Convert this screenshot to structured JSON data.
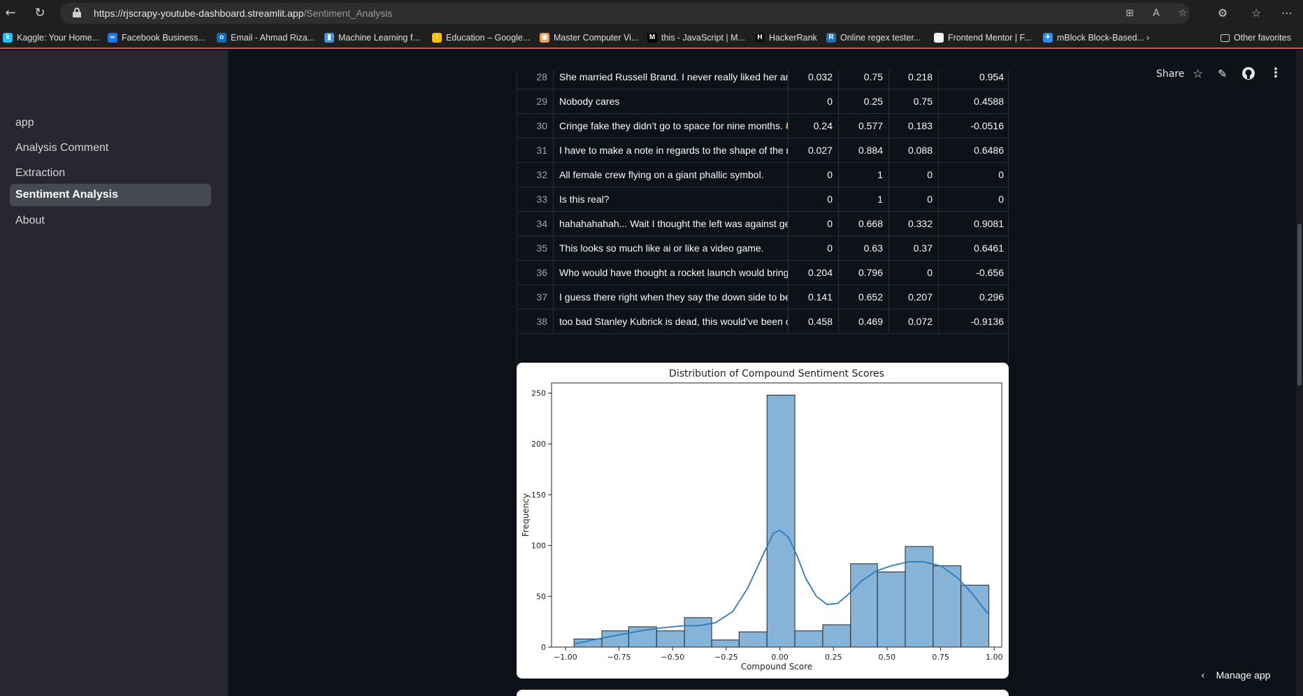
{
  "browser": {
    "url_host": "https://rjscrapy-youtube-dashboard.streamlit.app",
    "url_path": "/Sentiment_Analysis",
    "bookmarks": [
      {
        "label": "Kaggle: Your Home...",
        "color": "#20beff",
        "glyph": "k"
      },
      {
        "label": "Facebook Business...",
        "color": "#1877f2",
        "glyph": "∞"
      },
      {
        "label": "Email - Ahmad Riza...",
        "color": "#0f6cbd",
        "glyph": "o"
      },
      {
        "label": "Machine Learning f...",
        "color": "#4a90d9",
        "glyph": "▮"
      },
      {
        "label": "Education – Google...",
        "color": "#fbbc04",
        "glyph": "⁞"
      },
      {
        "label": "Master Computer Vi...",
        "color": "#e8a25a",
        "glyph": "◉"
      },
      {
        "label": "this - JavaScript | M...",
        "color": "#000000",
        "glyph": "M"
      },
      {
        "label": "HackerRank",
        "color": "#111111",
        "glyph": "H"
      },
      {
        "label": "Online regex tester...",
        "color": "#2b6cb0",
        "glyph": "R"
      },
      {
        "label": "Frontend Mentor | F...",
        "color": "#f5f5f5",
        "glyph": " "
      },
      {
        "label": "mBlock Block-Based...",
        "color": "#2d8cf0",
        "glyph": "✦"
      }
    ],
    "other_favorites": "Other favorites"
  },
  "sidebar": {
    "items": [
      {
        "label": "app",
        "active": false
      },
      {
        "label": "Analysis Comment",
        "active": false
      },
      {
        "label": "Extraction",
        "active": false
      },
      {
        "label": "Sentiment Analysis",
        "active": true
      },
      {
        "label": "About",
        "active": false
      }
    ]
  },
  "toolbar": {
    "share": "Share",
    "manage_app": "Manage app"
  },
  "table": {
    "rows": [
      {
        "idx": "28",
        "text": "She married Russell Brand. I never really liked her and th",
        "neg": "0.032",
        "neu": "0.75",
        "pos": "0.218",
        "compound": "0.954"
      },
      {
        "idx": "29",
        "text": "Nobody cares",
        "neg": "0",
        "neu": "0.25",
        "pos": "0.75",
        "compound": "0.4588"
      },
      {
        "idx": "30",
        "text": "Cringe fake they didn’t go to space for nine months. 😂",
        "neg": "0.24",
        "neu": "0.577",
        "pos": "0.183",
        "compound": "-0.0516"
      },
      {
        "idx": "31",
        "text": "I have to make a note in regards to the shape of the rocke",
        "neg": "0.027",
        "neu": "0.884",
        "pos": "0.088",
        "compound": "0.6486"
      },
      {
        "idx": "32",
        "text": "All female crew flying on a giant phallic symbol.",
        "neg": "0",
        "neu": "1",
        "pos": "0",
        "compound": "0"
      },
      {
        "idx": "33",
        "text": "Is this real?",
        "neg": "0",
        "neu": "1",
        "pos": "0",
        "compound": "0"
      },
      {
        "idx": "34",
        "text": "hahahahahah... Wait I thought the left was against gettin",
        "neg": "0",
        "neu": "0.668",
        "pos": "0.332",
        "compound": "0.9081"
      },
      {
        "idx": "35",
        "text": "This looks so much like ai or like a video game.",
        "neg": "0",
        "neu": "0.63",
        "pos": "0.37",
        "compound": "0.6461"
      },
      {
        "idx": "36",
        "text": "Who would have thought a rocket launch would bring the",
        "neg": "0.204",
        "neu": "0.796",
        "pos": "0",
        "compound": "-0.656"
      },
      {
        "idx": "37",
        "text": "I guess there right when they say the down side to beaut",
        "neg": "0.141",
        "neu": "0.652",
        "pos": "0.207",
        "compound": "0.296"
      },
      {
        "idx": "38",
        "text": "too bad Stanley Kubrick is dead, this would’ve been crea",
        "neg": "0.458",
        "neu": "0.469",
        "pos": "0.072",
        "compound": "-0.9136"
      }
    ]
  },
  "chart_data": {
    "type": "bar",
    "title": "Distribution of Compound Sentiment Scores",
    "xlabel": "Compound Score",
    "ylabel": "Frequency",
    "xlim": [
      -1.0,
      1.0
    ],
    "ylim": [
      0,
      260
    ],
    "bin_edges": [
      -0.9625,
      -0.8375,
      -0.7125,
      -0.5875,
      -0.4625,
      -0.3375,
      -0.2125,
      -0.0875,
      0.0375,
      0.1625,
      0.2875,
      0.4125,
      0.5375,
      0.6625,
      0.7875,
      0.9125,
      1.0
    ],
    "bins": [
      {
        "x0": -0.96,
        "x1": -0.83,
        "value": 8
      },
      {
        "x0": -0.83,
        "x1": -0.705,
        "value": 16
      },
      {
        "x0": -0.705,
        "x1": -0.575,
        "value": 20
      },
      {
        "x0": -0.575,
        "x1": -0.445,
        "value": 16
      },
      {
        "x0": -0.445,
        "x1": -0.318,
        "value": 29
      },
      {
        "x0": -0.318,
        "x1": -0.19,
        "value": 7
      },
      {
        "x0": -0.19,
        "x1": -0.06,
        "value": 15
      },
      {
        "x0": -0.06,
        "x1": 0.07,
        "value": 248
      },
      {
        "x0": 0.07,
        "x1": 0.2,
        "value": 16
      },
      {
        "x0": 0.2,
        "x1": 0.33,
        "value": 22
      },
      {
        "x0": 0.33,
        "x1": 0.455,
        "value": 82
      },
      {
        "x0": 0.455,
        "x1": 0.585,
        "value": 74
      },
      {
        "x0": 0.585,
        "x1": 0.715,
        "value": 99
      },
      {
        "x0": 0.715,
        "x1": 0.845,
        "value": 80
      },
      {
        "x0": 0.845,
        "x1": 0.975,
        "value": 61
      }
    ],
    "kde": {
      "x": [
        -0.96,
        -0.85,
        -0.75,
        -0.65,
        -0.55,
        -0.45,
        -0.38,
        -0.3,
        -0.22,
        -0.15,
        -0.08,
        -0.03,
        0.0,
        0.04,
        0.08,
        0.12,
        0.17,
        0.22,
        0.27,
        0.32,
        0.38,
        0.45,
        0.52,
        0.6,
        0.67,
        0.75,
        0.83,
        0.9,
        0.97
      ],
      "y": [
        3,
        8,
        12,
        16,
        19,
        21,
        21,
        24,
        35,
        58,
        90,
        112,
        115,
        108,
        90,
        68,
        50,
        42,
        43,
        52,
        65,
        75,
        80,
        84,
        84,
        80,
        68,
        52,
        33
      ]
    },
    "xticks": [
      "−1.00",
      "−0.75",
      "−0.50",
      "−0.25",
      "0.00",
      "0.25",
      "0.50",
      "0.75",
      "1.00"
    ],
    "yticks": [
      "0",
      "50",
      "100",
      "150",
      "200",
      "250"
    ],
    "bar_color": "#86b4d8",
    "line_color": "#2b7bba"
  }
}
